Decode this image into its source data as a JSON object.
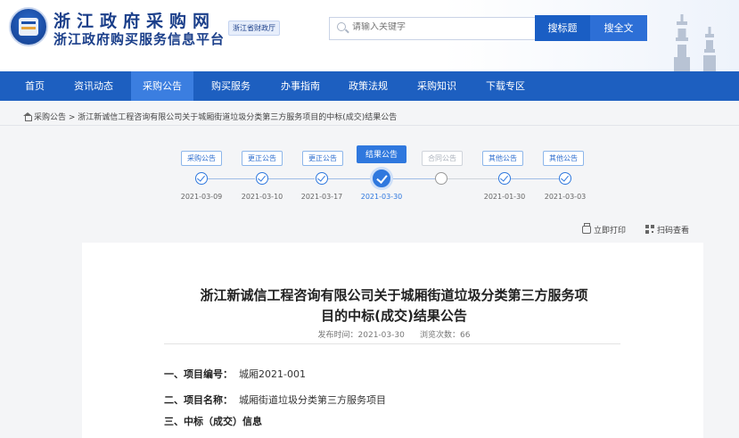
{
  "header": {
    "site_name": "浙江政府采购网",
    "site_sub": "浙江政府购买服务信息平台",
    "tag": "浙江省财政厅",
    "search_placeholder": "请输入关键字",
    "btn_title": "搜标题",
    "btn_full": "搜全文"
  },
  "nav": [
    "首页",
    "资讯动态",
    "采购公告",
    "购买服务",
    "办事指南",
    "政策法规",
    "采购知识",
    "下载专区"
  ],
  "nav_active": "采购公告",
  "breadcrumb": {
    "root": "采购公告",
    "sep": " > ",
    "current": "浙江新诚信工程咨询有限公司关于城厢街道垃圾分类第三方服务项目的中标(成交)结果公告"
  },
  "timeline": [
    {
      "label": "采购公告",
      "date": "2021-03-09",
      "state": "done"
    },
    {
      "label": "更正公告",
      "date": "2021-03-10",
      "state": "done"
    },
    {
      "label": "更正公告",
      "date": "2021-03-17",
      "state": "done"
    },
    {
      "label": "结果公告",
      "date": "2021-03-30",
      "state": "current"
    },
    {
      "label": "合同公告",
      "date": "",
      "state": "empty"
    },
    {
      "label": "其他公告",
      "date": "2021-01-30",
      "state": "done"
    },
    {
      "label": "其他公告",
      "date": "2021-03-03",
      "state": "done"
    }
  ],
  "tools": {
    "print": "立即打印",
    "qr": "扫码查看"
  },
  "doc": {
    "title_line1": "浙江新诚信工程咨询有限公司关于城厢街道垃圾分类第三方服务项",
    "title_line2": "目的中标(成交)结果公告",
    "publish_label": "发布时间：",
    "publish_date": "2021-03-30",
    "views_label": "浏览次数：",
    "views": "66",
    "fields": [
      {
        "label": "一、项目编号：",
        "value": "城厢2021-001"
      },
      {
        "label": "二、项目名称：",
        "value": "城厢街道垃圾分类第三方服务项目"
      },
      {
        "label": "三、中标（成交）信息",
        "value": ""
      }
    ]
  }
}
